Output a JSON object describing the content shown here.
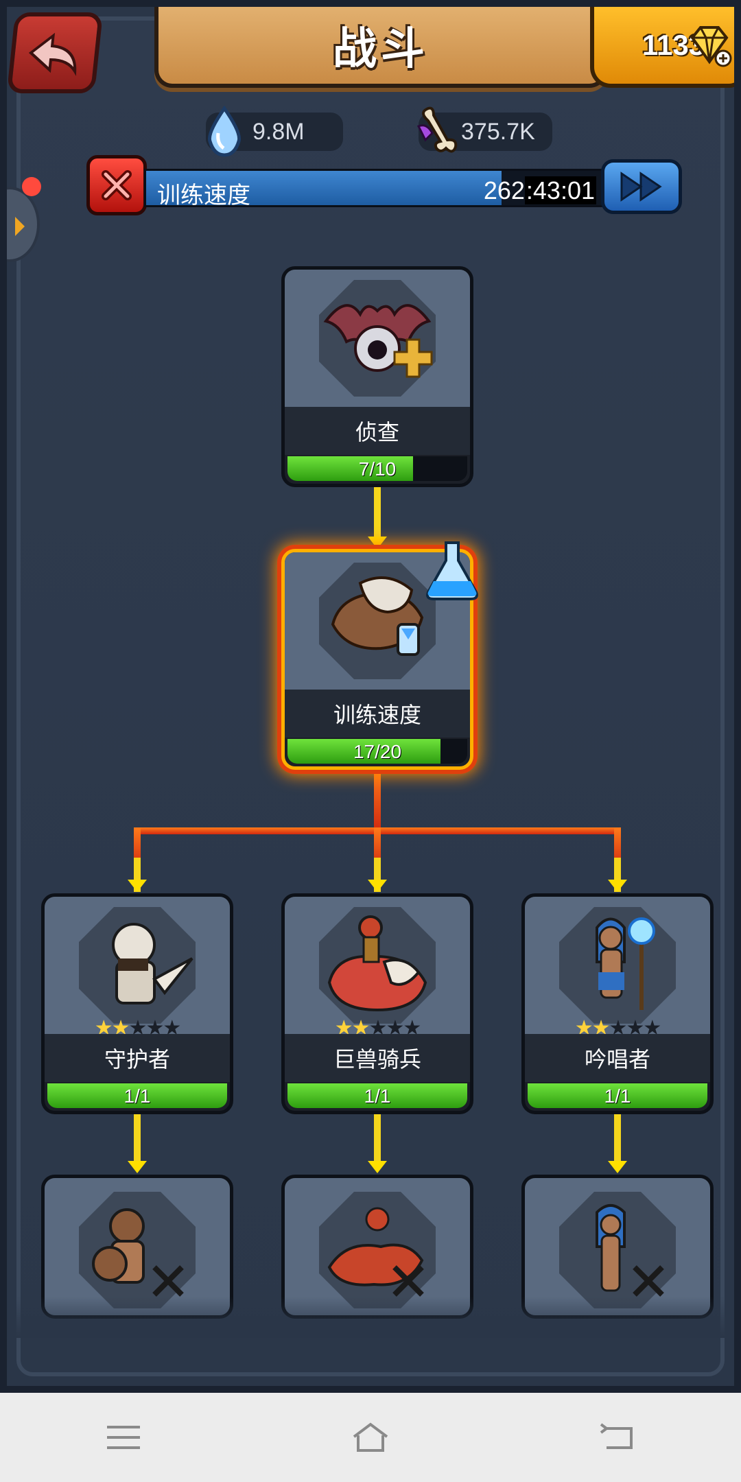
{
  "header": {
    "title": "战斗",
    "gems": "1133"
  },
  "resources": {
    "water": "9.8M",
    "bones": "375.7K"
  },
  "training": {
    "label": "训练速度",
    "time_hours": "262",
    "time_rest": ":43:01",
    "progress": 0.78
  },
  "tree": {
    "scout": {
      "name": "侦查",
      "progress_text": "7/10",
      "progress": 0.7
    },
    "training_speed": {
      "name": "训练速度",
      "progress_text": "17/20",
      "progress": 0.85
    },
    "guardian": {
      "name": "守护者",
      "progress_text": "1/1",
      "progress": 1.0,
      "stars": 2
    },
    "beast_rider": {
      "name": "巨兽骑兵",
      "progress_text": "1/1",
      "progress": 1.0,
      "stars": 2
    },
    "chanter": {
      "name": "吟唱者",
      "progress_text": "1/1",
      "progress": 1.0,
      "stars": 2
    }
  },
  "icons": {
    "back": "back-arrow-icon",
    "gem": "gem-icon",
    "water": "water-drop-icon",
    "bone": "bone-icon",
    "cancel": "cancel-icon",
    "speedup": "fast-forward-icon",
    "flask": "flask-icon"
  },
  "colors": {
    "progress_green": "#3fbf1a",
    "timer_blue": "#2a6fb8",
    "active_glow": "#ff8a00"
  }
}
